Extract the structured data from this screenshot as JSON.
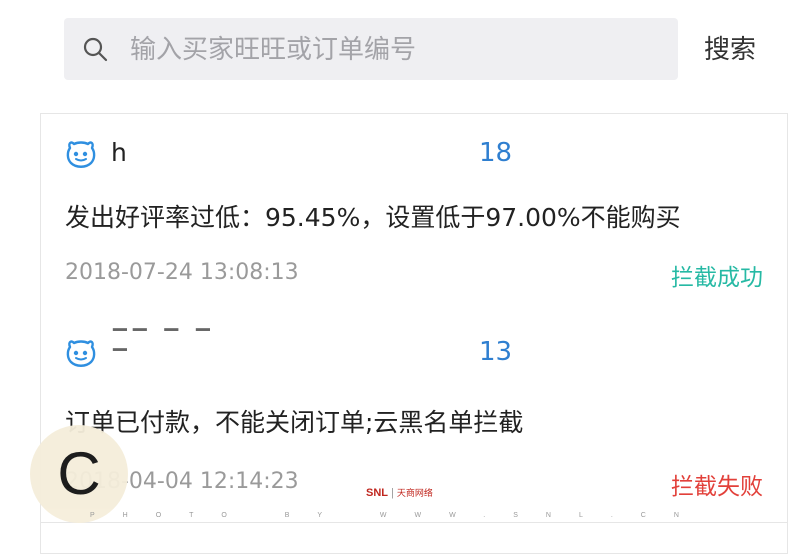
{
  "search": {
    "placeholder": "输入买家旺旺或订单编号",
    "button_label": "搜索"
  },
  "orders": [
    {
      "buyer_name": "h",
      "order_number": "18",
      "message": "发出好评率过低：95.45%，设置低于97.00%不能购买",
      "timestamp": "2018-07-24 13:08:13",
      "status": "拦截成功",
      "status_color": "#26b9a4"
    },
    {
      "buyer_name": "",
      "order_number": "13",
      "message": "订单已付款，不能关闭订单;云黑名单拦截",
      "timestamp": "2018-04-04 12:14:23",
      "status": "拦截失败",
      "status_color": "#e2403a"
    }
  ],
  "overlay": {
    "badge_letter": "C"
  },
  "watermark": {
    "logo": "SNL",
    "logo_cn": "天商网络",
    "line": "PHOTO BY WWW.SNL.CN"
  }
}
